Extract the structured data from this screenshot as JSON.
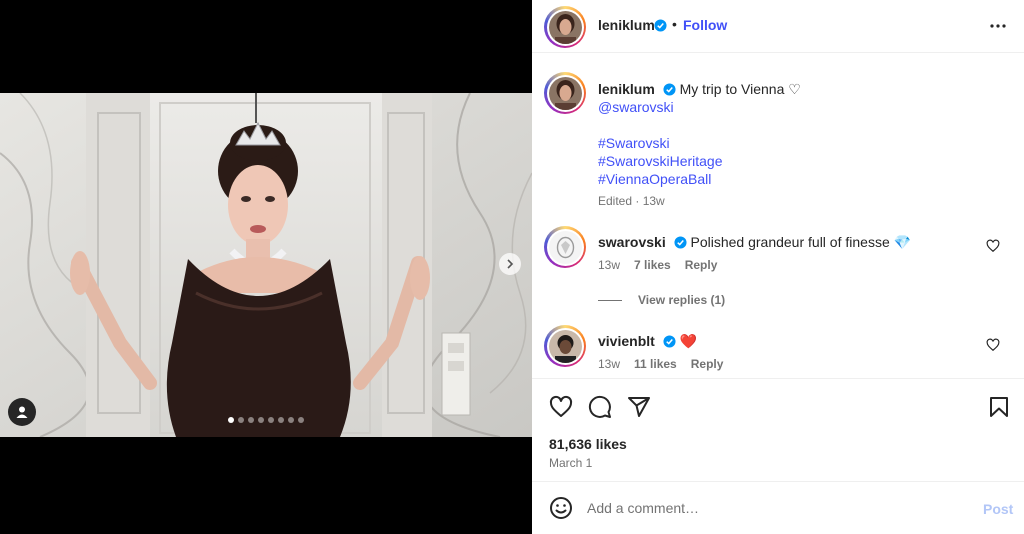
{
  "post": {
    "username": "leniklum",
    "follow_label": "Follow",
    "separator": "•",
    "more_icon": "ellipsis-icon",
    "image_count": 8,
    "active_image": 1
  },
  "caption": {
    "username": "leniklum",
    "text": "My trip to Vienna ♡",
    "mention": "@swarovski",
    "hashtags": [
      "#Swarovski",
      "#SwarovskiHeritage",
      "#ViennaOperaBall"
    ],
    "meta": "Edited · 13w"
  },
  "comments": [
    {
      "username": "swarovski",
      "text": "Polished grandeur full of finesse",
      "emoji": "💎",
      "time": "13w",
      "likes": "7 likes",
      "reply": "Reply"
    },
    {
      "username": "vivienblt",
      "text": "",
      "emoji": "❤️",
      "time": "13w",
      "likes": "11 likes",
      "reply": "Reply"
    }
  ],
  "view_replies": "View replies (1)",
  "likes_count": "81,636 likes",
  "date": "March 1",
  "comment_box": {
    "placeholder": "Add a comment…",
    "post_label": "Post"
  },
  "colors": {
    "link": "#4150f7",
    "verified": "#0095f6",
    "post_disabled": "#b2c6f7",
    "heart_red": "#ed4956"
  }
}
